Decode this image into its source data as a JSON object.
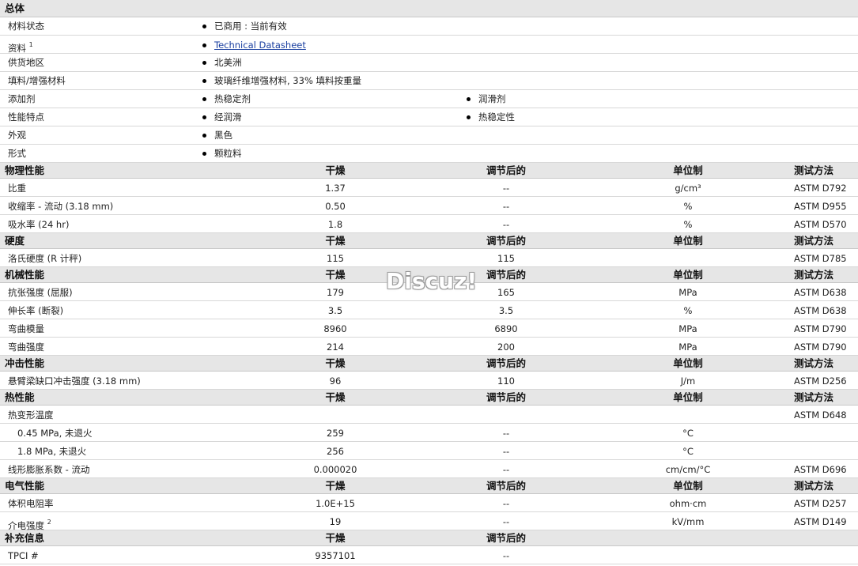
{
  "general": {
    "title": "总体",
    "rows": [
      {
        "label": "材料状态",
        "values": [
          "已商用 : 当前有效"
        ]
      },
      {
        "label": "资料",
        "sup": "1",
        "values": [
          "Technical Datasheet"
        ],
        "link": true
      },
      {
        "label": "供货地区",
        "values": [
          "北美洲"
        ]
      },
      {
        "label": "填料/增强材料",
        "values": [
          "玻璃纤维增强材料, 33% 填料按重量"
        ]
      },
      {
        "label": "添加剂",
        "values": [
          "热稳定剂",
          "润滑剂"
        ]
      },
      {
        "label": "性能特点",
        "values": [
          "经润滑",
          "热稳定性"
        ]
      },
      {
        "label": "外观",
        "values": [
          "黑色"
        ]
      },
      {
        "label": "形式",
        "values": [
          "颗粒料"
        ]
      }
    ]
  },
  "column_headers": {
    "dry": "干燥",
    "conditioned": "调节后的",
    "unit": "单位制",
    "method": "测试方法"
  },
  "sections": [
    {
      "title": "物理性能",
      "rows": [
        {
          "name": "比重",
          "dry": "1.37",
          "cond": "--",
          "unit": "g/cm³",
          "method": "ASTM D792"
        },
        {
          "name": "收缩率 - 流动 (3.18 mm)",
          "dry": "0.50",
          "cond": "--",
          "unit": "%",
          "method": "ASTM D955"
        },
        {
          "name": "吸水率 (24 hr)",
          "dry": "1.8",
          "cond": "--",
          "unit": "%",
          "method": "ASTM D570"
        }
      ]
    },
    {
      "title": "硬度",
      "rows": [
        {
          "name": "洛氏硬度 (R 计秤)",
          "dry": "115",
          "cond": "115",
          "unit": "",
          "method": "ASTM D785"
        }
      ]
    },
    {
      "title": "机械性能",
      "rows": [
        {
          "name": "抗张强度 (屈服)",
          "dry": "179",
          "cond": "165",
          "unit": "MPa",
          "method": "ASTM D638"
        },
        {
          "name": "伸长率 (断裂)",
          "dry": "3.5",
          "cond": "3.5",
          "unit": "%",
          "method": "ASTM D638"
        },
        {
          "name": "弯曲模量",
          "dry": "8960",
          "cond": "6890",
          "unit": "MPa",
          "method": "ASTM D790"
        },
        {
          "name": "弯曲强度",
          "dry": "214",
          "cond": "200",
          "unit": "MPa",
          "method": "ASTM D790"
        }
      ]
    },
    {
      "title": "冲击性能",
      "rows": [
        {
          "name": "悬臂梁缺口冲击强度 (3.18 mm)",
          "dry": "96",
          "cond": "110",
          "unit": "J/m",
          "method": "ASTM D256"
        }
      ]
    },
    {
      "title": "热性能",
      "rows": [
        {
          "name": "热变形温度",
          "dry": "",
          "cond": "",
          "unit": "",
          "method": "ASTM D648"
        },
        {
          "name": "0.45 MPa, 未退火",
          "indent": true,
          "dry": "259",
          "cond": "--",
          "unit": "°C",
          "method": ""
        },
        {
          "name": "1.8 MPa, 未退火",
          "indent": true,
          "dry": "256",
          "cond": "--",
          "unit": "°C",
          "method": ""
        },
        {
          "name": "线形膨胀系数 - 流动",
          "dry": "0.000020",
          "cond": "--",
          "unit": "cm/cm/°C",
          "method": "ASTM D696"
        }
      ]
    },
    {
      "title": "电气性能",
      "rows": [
        {
          "name": "体积电阻率",
          "dry": "1.0E+15",
          "cond": "--",
          "unit": "ohm·cm",
          "method": "ASTM D257"
        },
        {
          "name": "介电强度",
          "sup": "2",
          "dry": "19",
          "cond": "--",
          "unit": "kV/mm",
          "method": "ASTM D149"
        }
      ]
    },
    {
      "title": "补充信息",
      "short_header": true,
      "rows": [
        {
          "name": "TPCI #",
          "dry": "9357101",
          "cond": "--",
          "unit": "",
          "method": ""
        }
      ]
    }
  ],
  "watermark": "Discuz!"
}
